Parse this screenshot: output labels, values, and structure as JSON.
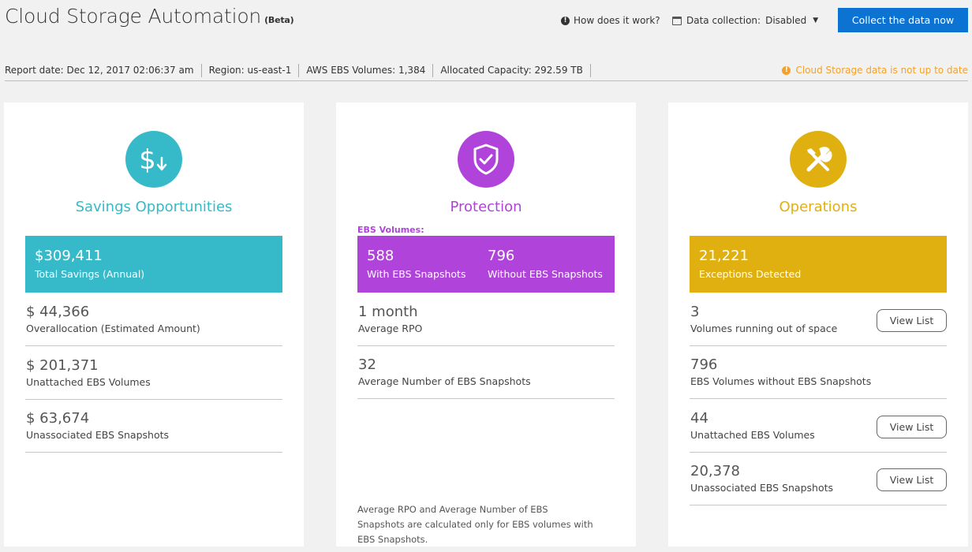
{
  "header": {
    "title": "Cloud Storage Automation",
    "beta": "(Beta)",
    "how_it_works": "How does it work?",
    "data_collection_label": "Data collection:",
    "data_collection_value": "Disabled",
    "collect_button": "Collect the data now"
  },
  "report": {
    "date": "Report date: Dec 12, 2017 02:06:37 am",
    "region": "Region: us-east-1",
    "volumes": "AWS EBS Volumes: 1,384",
    "capacity": "Allocated Capacity: 292.59 TB",
    "warning": "Cloud Storage data is not up to date"
  },
  "colors": {
    "savings": "#36bac9",
    "protection": "#b043d9",
    "operations": "#e0b010",
    "primary_button": "#0c73d3",
    "warning": "#f2a22a"
  },
  "savings": {
    "icon": "dollar-down-icon",
    "title": "Savings Opportunities",
    "hero_value": "$309,411",
    "hero_label": "Total Savings (Annual)",
    "rows": [
      {
        "value": "$ 44,366",
        "label": "Overallocation (Estimated Amount)"
      },
      {
        "value": "$ 201,371",
        "label": "Unattached EBS Volumes"
      },
      {
        "value": "$ 63,674",
        "label": "Unassociated EBS Snapshots"
      }
    ]
  },
  "protection": {
    "icon": "shield-check-icon",
    "title": "Protection",
    "sublabel": "EBS Volumes:",
    "hero_left_value": "588",
    "hero_left_label": "With EBS Snapshots",
    "hero_right_value": "796",
    "hero_right_label": "Without EBS Snapshots",
    "rows": [
      {
        "value": "1 month",
        "label": "Average RPO"
      },
      {
        "value": "32",
        "label": "Average Number of EBS Snapshots"
      }
    ],
    "footnote": "Average RPO and Average Number of EBS Snapshots are calculated only for EBS volumes with EBS Snapshots."
  },
  "operations": {
    "icon": "tools-icon",
    "title": "Operations",
    "hero_value": "21,221",
    "hero_label": "Exceptions Detected",
    "view_list": "View List",
    "rows": [
      {
        "value": "3",
        "label": "Volumes running out of space"
      },
      {
        "value": "796",
        "label": "EBS Volumes without EBS Snapshots"
      },
      {
        "value": "44",
        "label": "Unattached EBS Volumes"
      },
      {
        "value": "20,378",
        "label": "Unassociated EBS Snapshots"
      }
    ]
  }
}
